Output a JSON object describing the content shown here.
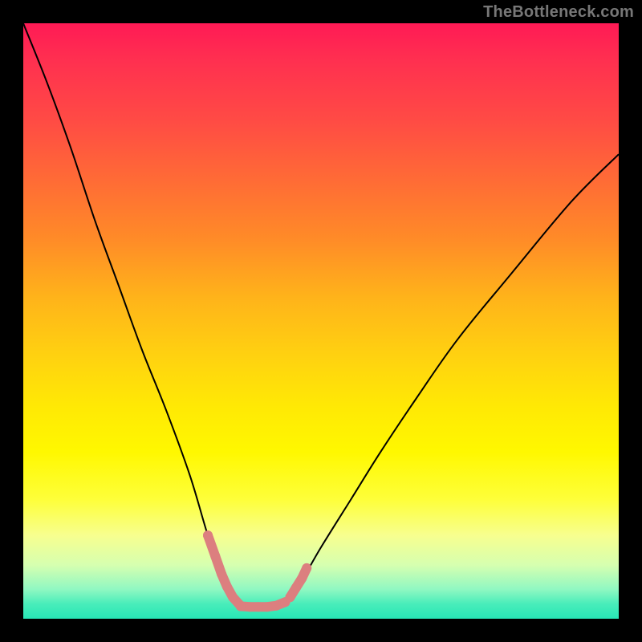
{
  "watermark": {
    "text": "TheBottleneck.com"
  },
  "chart_data": {
    "type": "line",
    "title": "",
    "xlabel": "",
    "ylabel": "",
    "xlim": [
      0,
      100
    ],
    "ylim": [
      0,
      100
    ],
    "grid": false,
    "legend": false,
    "background_gradient": {
      "orientation": "vertical",
      "stops": [
        {
          "pos": 0.0,
          "color": "#ff1a55"
        },
        {
          "pos": 0.36,
          "color": "#ff8a28"
        },
        {
          "pos": 0.72,
          "color": "#fff800"
        },
        {
          "pos": 1.0,
          "color": "#27e6b6"
        }
      ]
    },
    "series": [
      {
        "name": "bottleneck-curve",
        "x": [
          0,
          4,
          8,
          12,
          16,
          20,
          24,
          28,
          31,
          33.5,
          35.5,
          37,
          39.5,
          42,
          44,
          46.5,
          50,
          55,
          60,
          66,
          73,
          82,
          92,
          100
        ],
        "values": [
          100,
          90,
          79,
          67,
          56,
          45,
          35,
          24,
          14,
          7,
          3,
          2,
          2,
          2,
          3,
          6,
          12,
          20,
          28,
          37,
          47,
          58,
          70,
          78
        ],
        "stroke": "#000000",
        "stroke_width": 2
      },
      {
        "name": "highlight-left-leg",
        "x": [
          31,
          32.25,
          33.3,
          34.2,
          35.2,
          36.2
        ],
        "values": [
          14,
          10.5,
          7.5,
          5.4,
          3.6,
          2.5
        ],
        "stroke": "#dc7f7f",
        "stroke_width": 12,
        "cap": "round"
      },
      {
        "name": "highlight-trough",
        "x": [
          36.5,
          38,
          39.5,
          41,
          42.5,
          44
        ],
        "values": [
          2.1,
          2.0,
          2.0,
          2.0,
          2.2,
          2.8
        ],
        "stroke": "#dc7f7f",
        "stroke_width": 12,
        "cap": "round"
      },
      {
        "name": "highlight-right-leg",
        "x": [
          44.8,
          45.8,
          46.8,
          47.6
        ],
        "values": [
          3.6,
          5.2,
          6.8,
          8.5
        ],
        "stroke": "#dc7f7f",
        "stroke_width": 12,
        "cap": "round"
      }
    ]
  }
}
